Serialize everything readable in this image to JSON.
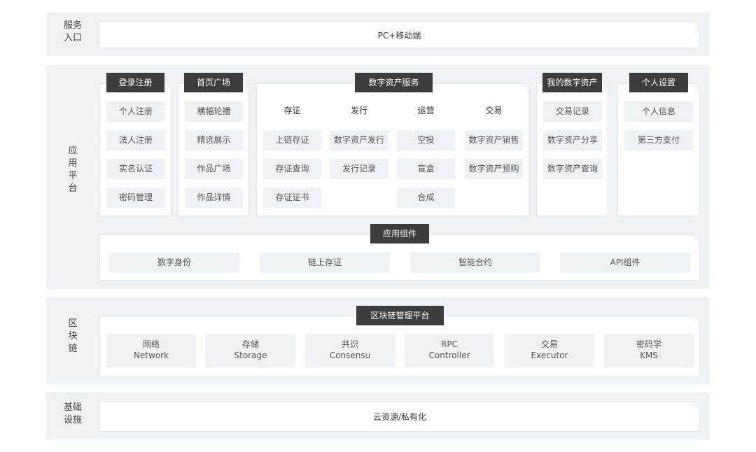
{
  "service_entry": {
    "label_lines": [
      "服务",
      "入口"
    ],
    "box_text": "PC+移动端"
  },
  "app_platform": {
    "label_lines": [
      "应",
      "用",
      "平",
      "台"
    ],
    "login": {
      "title": "登录注册",
      "items": [
        "个人注册",
        "法人注册",
        "实名认证",
        "密码管理"
      ]
    },
    "home": {
      "title": "首页广场",
      "items": [
        "横幅轮播",
        "精选展示",
        "作品广场",
        "作品详情"
      ]
    },
    "digital_service": {
      "title": "数字资产服务",
      "columns": [
        {
          "header": "存证",
          "items": [
            "上链存证",
            "存证查询",
            "存证证书"
          ]
        },
        {
          "header": "发行",
          "items": [
            "数字资产发行",
            "发行记录"
          ]
        },
        {
          "header": "运营",
          "items": [
            "空投",
            "盲盒",
            "合成"
          ]
        },
        {
          "header": "交易",
          "items": [
            "数字资产销售",
            "数字资产预购"
          ]
        }
      ]
    },
    "my_assets": {
      "title": "我的数字资产",
      "items": [
        "交易记录",
        "数字资产分享",
        "数字资产查询"
      ]
    },
    "settings": {
      "title": "个人设置",
      "items": [
        "个人信息",
        "第三方支付"
      ]
    },
    "components": {
      "title": "应用组件",
      "items": [
        "数字身份",
        "链上存证",
        "智能合约",
        "API组件"
      ]
    }
  },
  "blockchain": {
    "label_lines": [
      "区",
      "块",
      "链"
    ],
    "title": "区块链管理平台",
    "items": [
      {
        "cn": "网络",
        "en": "Network"
      },
      {
        "cn": "存储",
        "en": "Storage"
      },
      {
        "cn": "共识",
        "en": "Consensu"
      },
      {
        "cn": "RPC",
        "en": "Controller"
      },
      {
        "cn": "交易",
        "en": "Executor"
      },
      {
        "cn": "密码学",
        "en": "KMS"
      }
    ]
  },
  "infrastructure": {
    "label_lines": [
      "基础",
      "设施"
    ],
    "box_text": "云资源/私有化"
  }
}
